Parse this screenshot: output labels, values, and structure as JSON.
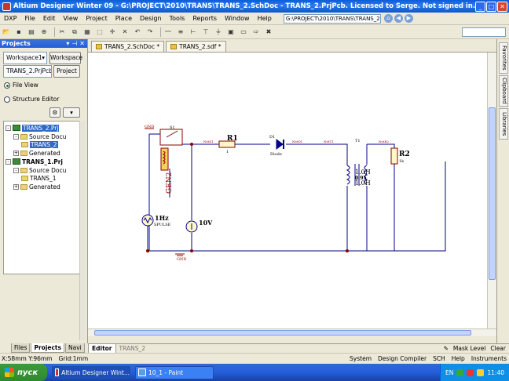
{
  "window": {
    "title": "Altium Designer Winter 09 - G:\\PROJECT\\2010\\TRANS\\TRANS_2.SchDoc - TRANS_2.PrjPcb. Licensed to Serge. Not signed in."
  },
  "menu": {
    "items": [
      "DXP",
      "File",
      "Edit",
      "View",
      "Project",
      "Place",
      "Design",
      "Tools",
      "Reports",
      "Window",
      "Help"
    ],
    "path": "G:\\PROJECT\\2010\\TRANS\\TRANS_2.S"
  },
  "panel": {
    "title": "Projects",
    "workspace_value": "Workspace1",
    "workspace_button": "Workspace",
    "project_value": "TRANS_2.PrjPcb",
    "project_button": "Project",
    "view_file": "File View",
    "view_structure": "Structure Editor",
    "tree": [
      {
        "label": "TRANS_2.Prj",
        "level": 0,
        "selected": true,
        "type": "project"
      },
      {
        "label": "Source Docu",
        "level": 1,
        "type": "folder"
      },
      {
        "label": "TRANS_2",
        "level": 2,
        "selected": true,
        "type": "doc"
      },
      {
        "label": "Generated",
        "level": 1,
        "type": "folder"
      },
      {
        "label": "TRANS_1.Prj",
        "level": 0,
        "type": "project"
      },
      {
        "label": "Source Docu",
        "level": 1,
        "type": "folder"
      },
      {
        "label": "TRANS_1",
        "level": 2,
        "type": "doc"
      },
      {
        "label": "Generated",
        "level": 1,
        "type": "folder"
      }
    ],
    "tabs": [
      "Files",
      "Projects",
      "Navi"
    ]
  },
  "doc_tabs": [
    "TRANS_2.SchDoc *",
    "TRANS_2.sdf *"
  ],
  "right_tabs": [
    "Favorites",
    "Clipboard",
    "Libraries"
  ],
  "editor_tabs": {
    "active": "Editor",
    "inactive": "TRANS_2",
    "right": [
      "Mask Level",
      "Clear"
    ]
  },
  "status": {
    "coords": "X:58mm Y:96mm",
    "grid": "Grid:1mm",
    "items": [
      "System",
      "Design Compiler",
      "SCH",
      "Help",
      "Instruments"
    ]
  },
  "taskbar": {
    "start": "пуск",
    "apps": [
      "Altium Designer Wint...",
      "10_1 - Paint"
    ],
    "lang": "EN",
    "time": "11:40"
  },
  "schematic": {
    "r1_label": "R1",
    "r1_value": "1",
    "r2_label": "R2",
    "r2_value": "1k",
    "gen_label": "GEN2",
    "gen_freq": "1Hz",
    "gen_sub": "SPULSE",
    "dc_value": "10V",
    "switch_label": "S1",
    "diode_label": "D1",
    "diode_sub": "Diode",
    "trans_label": "T1",
    "trans_l1": "1.0H",
    "trans_k": "0.95",
    "trans_l2": "1.0H",
    "gnd_top": "GND",
    "gnd_bottom": "GND",
    "net_labels": [
      "NetS1",
      "NetD1",
      "NetT1",
      "NetR2"
    ]
  }
}
